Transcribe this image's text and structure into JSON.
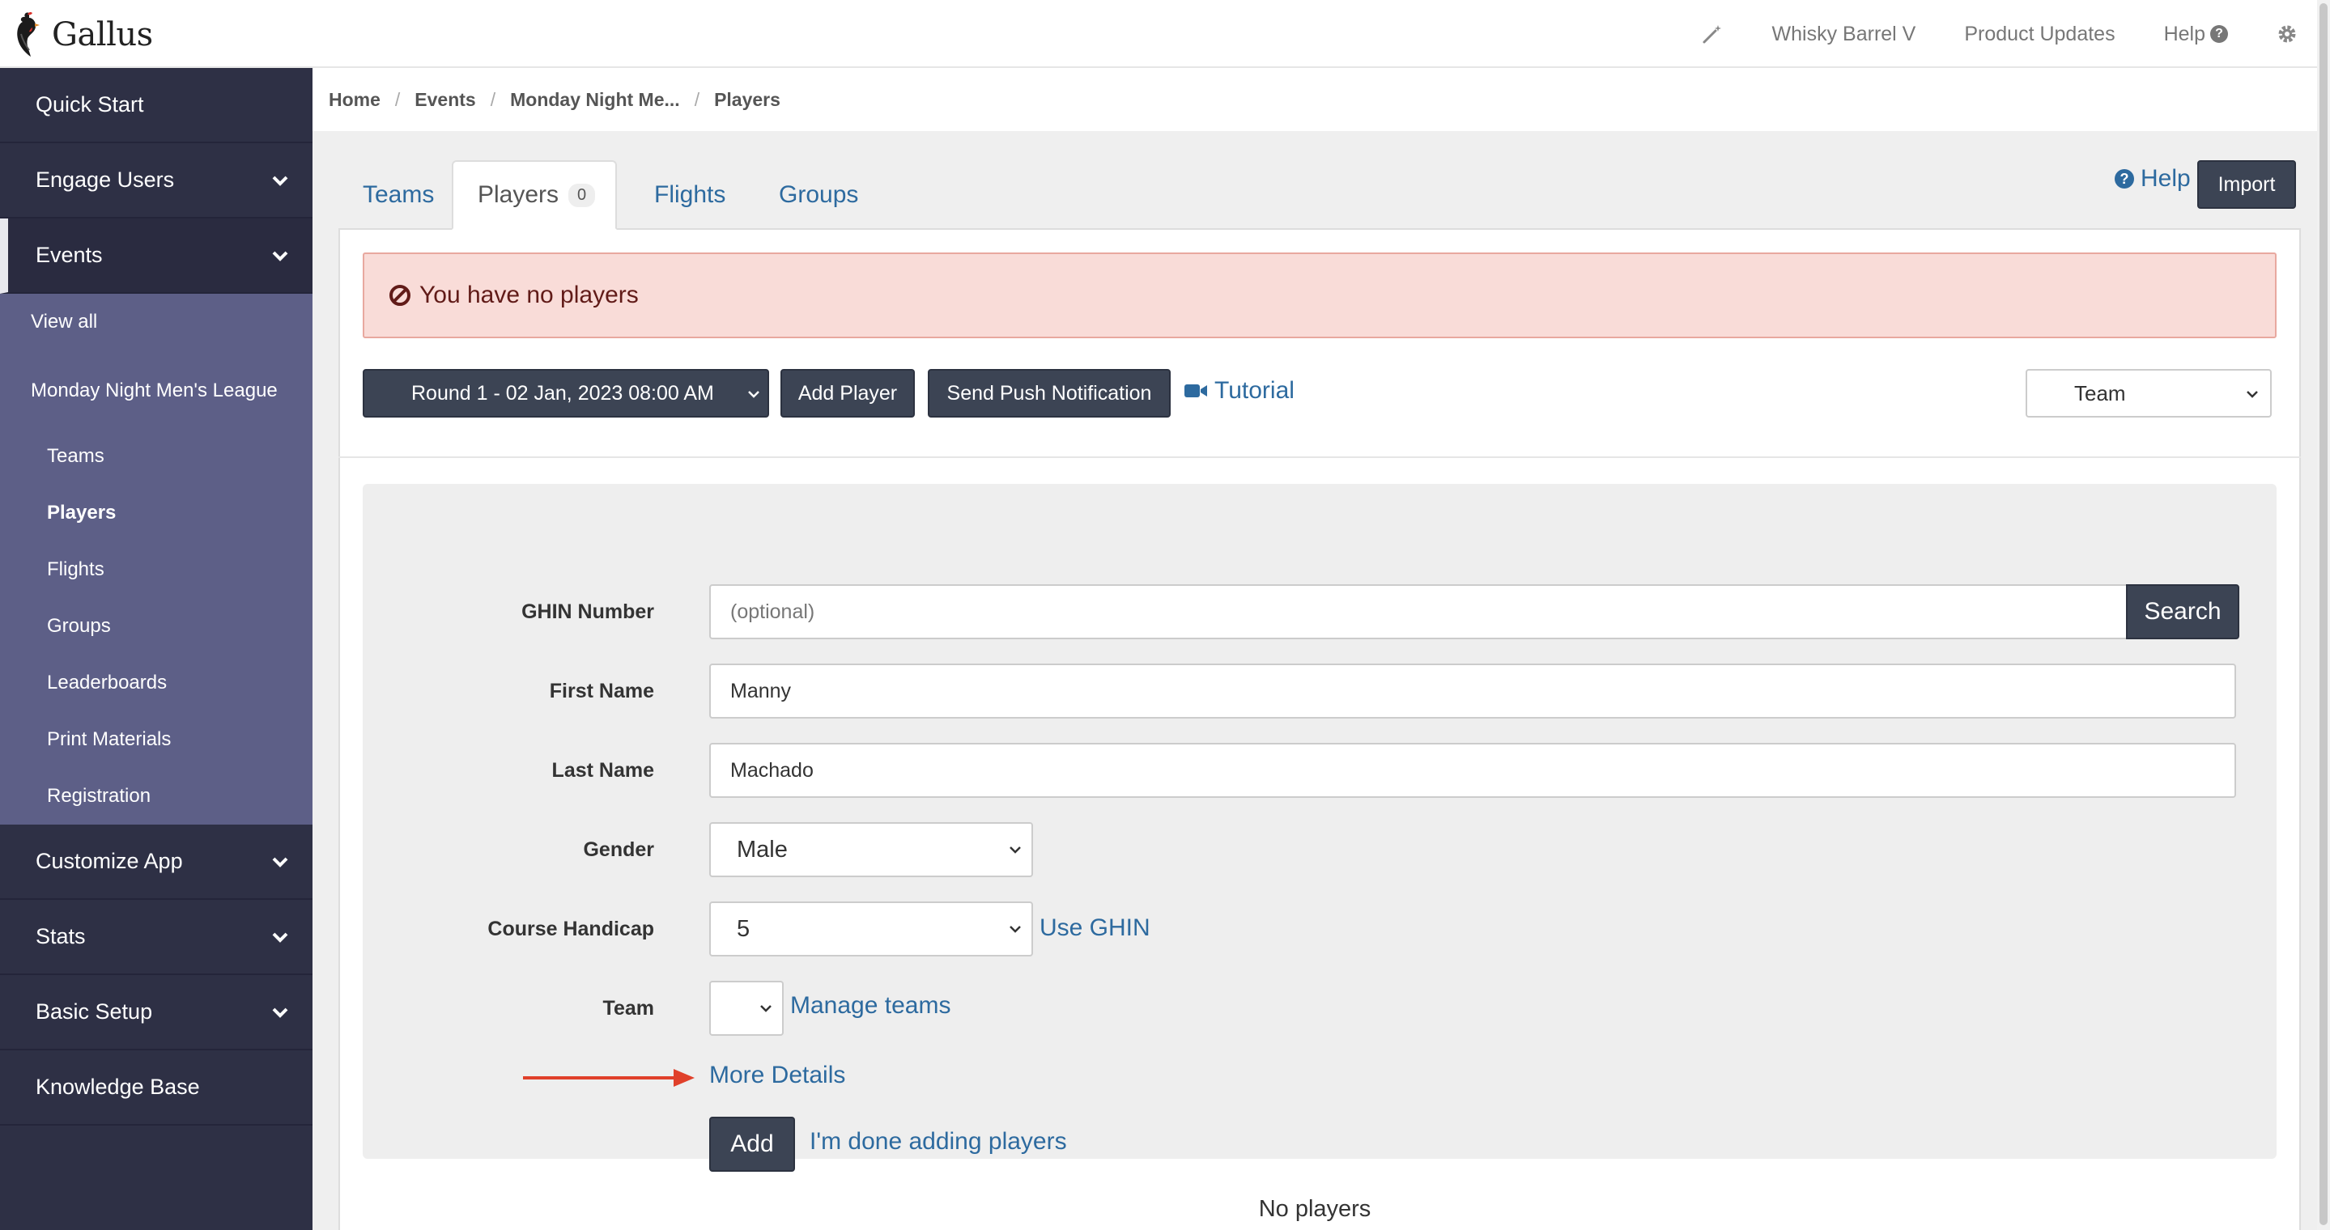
{
  "header": {
    "brand": "Gallus",
    "nav": [
      "Whisky Barrel V",
      "Product Updates",
      "Help"
    ]
  },
  "sidebar": {
    "items": [
      {
        "label": "Quick Start"
      },
      {
        "label": "Engage Users"
      },
      {
        "label": "Events"
      },
      {
        "label": "Customize App"
      },
      {
        "label": "Stats"
      },
      {
        "label": "Basic Setup"
      },
      {
        "label": "Knowledge Base"
      }
    ],
    "events_sub": {
      "view_all": "View all",
      "league": "Monday Night Men's League",
      "children": [
        "Teams",
        "Players",
        "Flights",
        "Groups",
        "Leaderboards",
        "Print Materials",
        "Registration"
      ]
    }
  },
  "breadcrumb": [
    "Home",
    "Events",
    "Monday Night Me...",
    "Players"
  ],
  "tabs": [
    {
      "label": "Teams"
    },
    {
      "label": "Players",
      "badge": "0"
    },
    {
      "label": "Flights"
    },
    {
      "label": "Groups"
    }
  ],
  "actions": {
    "help": "Help",
    "import": "Import",
    "round_select": "Round 1 - 02 Jan, 2023 08:00 AM",
    "add_player": "Add Player",
    "send_push": "Send Push Notification",
    "tutorial": "Tutorial",
    "group_by": "Team"
  },
  "alert": {
    "message": "You have no players",
    "color": "#f9dcd8"
  },
  "form": {
    "ghin_label": "GHIN Number",
    "ghin_placeholder": "(optional)",
    "search_label": "Search",
    "first_name_label": "First Name",
    "first_name_value": "Manny",
    "last_name_label": "Last Name",
    "last_name_value": "Machado",
    "gender_label": "Gender",
    "gender_value": "Male",
    "handicap_label": "Course Handicap",
    "handicap_value": "5",
    "use_ghin": "Use GHIN",
    "team_label": "Team",
    "team_value": "",
    "manage_teams": "Manage teams",
    "more_details": "More Details",
    "add_label": "Add",
    "done_label": "I'm done adding players"
  },
  "empty_state": "No players",
  "colors": {
    "sidebar": "#2e3045",
    "submenu": "#5d5f87",
    "link": "#2d6a9f",
    "dark_button": "#3c4454",
    "arrow": "#e0402a"
  }
}
